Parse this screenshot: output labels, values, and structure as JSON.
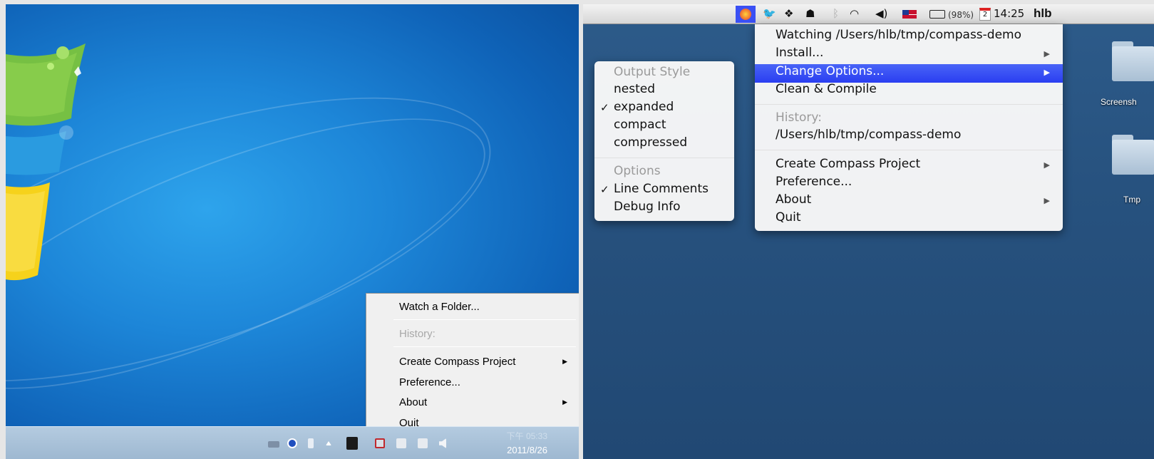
{
  "windows": {
    "menu": {
      "watch_folder": "Watch a Folder...",
      "history_header": "History:",
      "create_project": "Create Compass Project",
      "preference": "Preference...",
      "about": "About",
      "quit": "Quit"
    },
    "taskbar": {
      "time": "下午 05:33",
      "date": "2011/8/26"
    }
  },
  "mac": {
    "menubar": {
      "battery": "(98%)",
      "calendar_day": "2",
      "time": "14:25",
      "user": "hlb"
    },
    "main_menu": {
      "watching": "Watching /Users/hlb/tmp/compass-demo",
      "install": "Install...",
      "change_options": "Change Options...",
      "clean_compile": "Clean & Compile",
      "history_header": "History:",
      "history_item": "/Users/hlb/tmp/compass-demo",
      "create_project": "Create Compass Project",
      "preference": "Preference...",
      "about": "About",
      "quit": "Quit"
    },
    "options_menu": {
      "output_style_header": "Output Style",
      "nested": "nested",
      "expanded": "expanded",
      "compact": "compact",
      "compressed": "compressed",
      "options_header": "Options",
      "line_comments": "Line Comments",
      "debug_info": "Debug Info",
      "checkmark": "✓"
    },
    "desktop": {
      "folder1": "Screensh",
      "folder2": "Tmp"
    }
  },
  "colors": {
    "mac_highlight": "#3a50f4",
    "win_desktop": "#1d86d8"
  },
  "icons": [
    "windows-flag-logo",
    "keyboard-icon",
    "help-icon",
    "usb-icon",
    "show-hidden-icons-icon",
    "compass-app-icon",
    "network-icon",
    "speaker-icon",
    "twitter-icon",
    "dropbox-icon",
    "growl-icon",
    "bluetooth-icon",
    "wifi-icon",
    "flag-us-icon",
    "battery-icon",
    "calendar-icon",
    "folder-icon"
  ]
}
